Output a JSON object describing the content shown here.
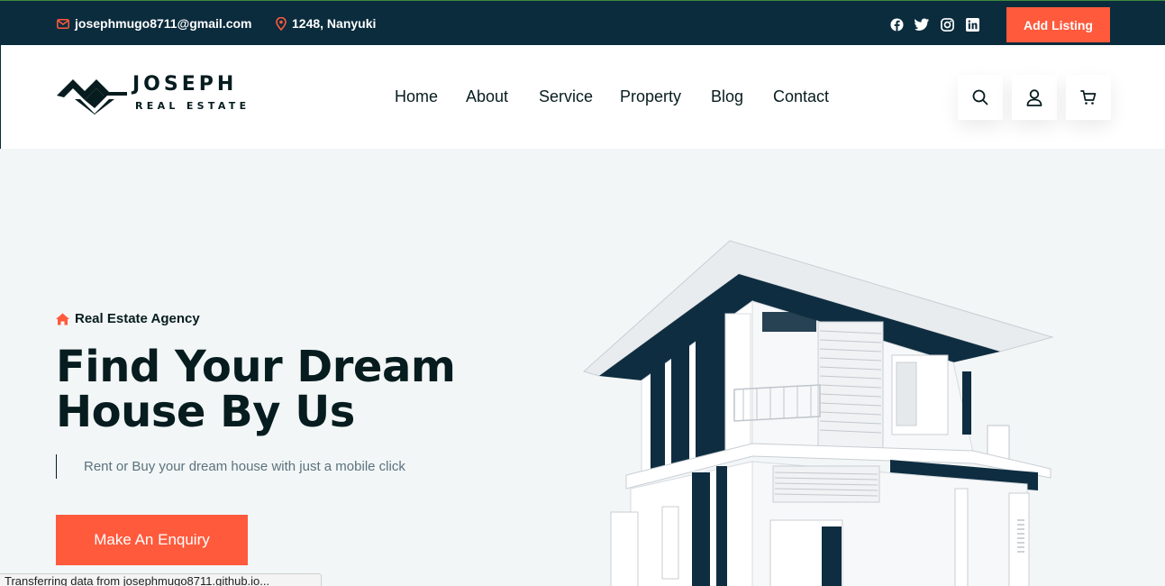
{
  "topbar": {
    "email": "josephmugo8711@gmail.com",
    "location": "1248, Nanyuki",
    "social_icons": [
      "facebook-icon",
      "twitter-icon",
      "instagram-icon",
      "linkedin-icon"
    ],
    "add_listing_label": "Add Listing"
  },
  "brand": {
    "name": "JOSEPH",
    "subtitle": "REAL ESTATE"
  },
  "nav": {
    "items": [
      {
        "label": "Home"
      },
      {
        "label": "About"
      },
      {
        "label": "Service"
      },
      {
        "label": "Property"
      },
      {
        "label": "Blog"
      },
      {
        "label": "Contact"
      }
    ]
  },
  "header_actions": [
    "search-icon",
    "user-icon",
    "cart-icon"
  ],
  "hero": {
    "tag": "Real Estate Agency",
    "title_line1": "Find Your Dream",
    "title_line2": "House By Us",
    "description": "Rent or Buy your dream house with just a mobile click",
    "cta_label": "Make An Enquiry"
  },
  "status_bar": {
    "text": "Transferring data from josephmugo8711.github.io..."
  },
  "colors": {
    "accent": "#ff5a3c",
    "dark": "#0b2c3d",
    "heading": "#071c1f",
    "hero_bg": "#f2f6f7"
  }
}
